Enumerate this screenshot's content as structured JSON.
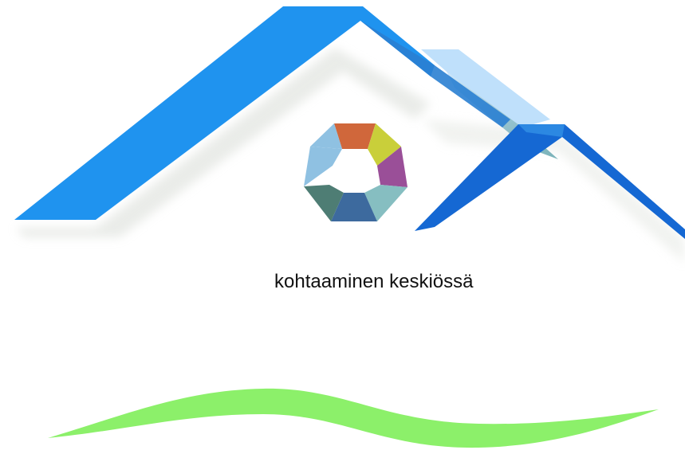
{
  "tagline": "kohtaaminen keskiössä",
  "colors": {
    "roof_large": "#1f93ef",
    "roof_small": "#1568d3",
    "roof_back": "#bfe0fb",
    "wave": "#8cf06a",
    "logo_segments": [
      "#d0673b",
      "#c9cf3a",
      "#9a4f98",
      "#86bec1",
      "#3d6a9e",
      "#4e7d74",
      "#8fc1e2"
    ]
  },
  "icons": {
    "logo": "heptagon-color-wheel-logo",
    "house": "house-roof-graphic",
    "wave": "green-wave-graphic"
  }
}
